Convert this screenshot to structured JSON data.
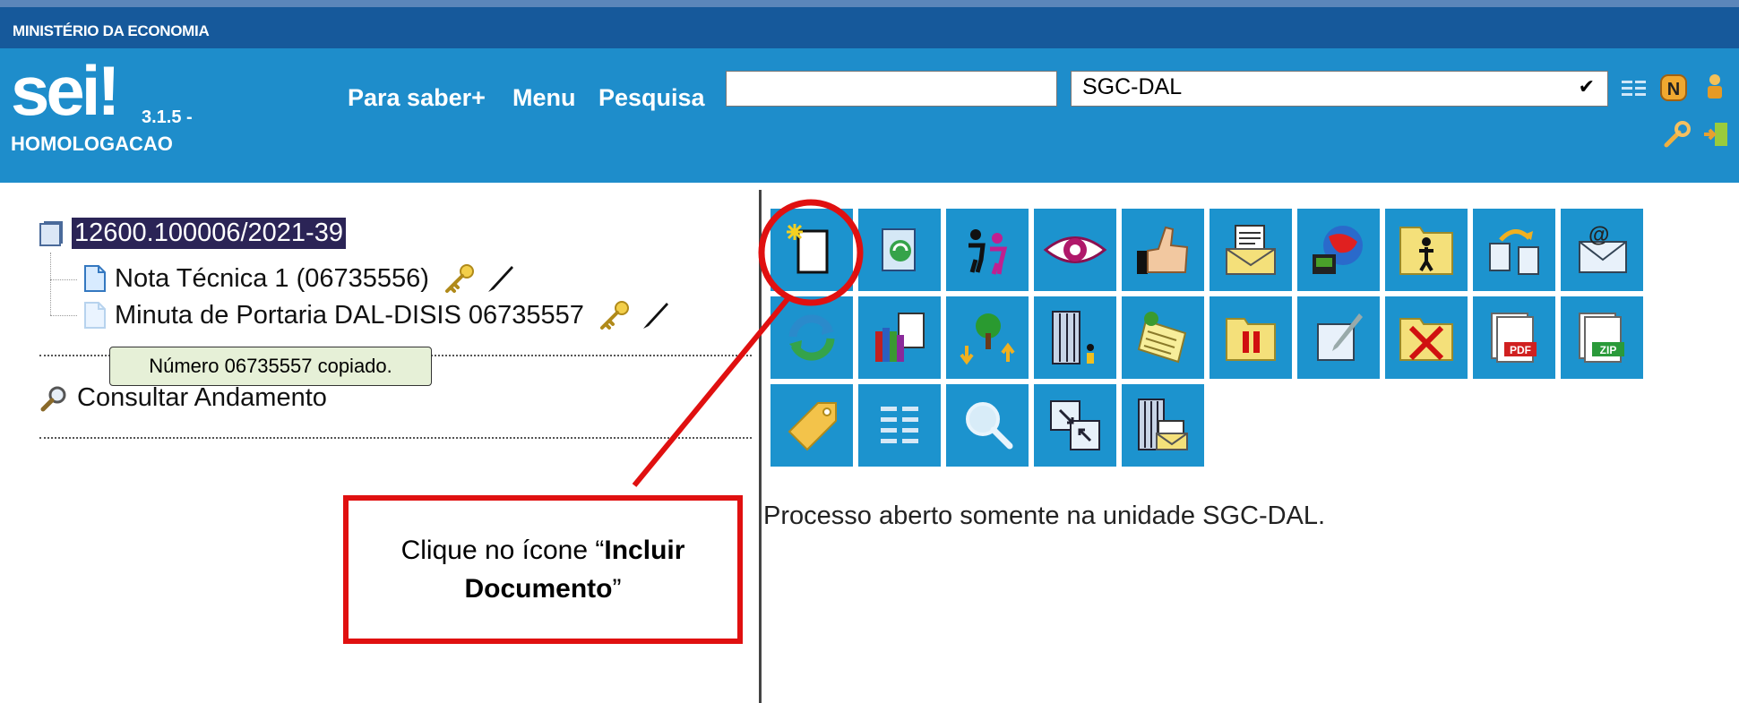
{
  "header": {
    "ministry": "MINISTÉRIO DA ECONOMIA",
    "logo_text": "sei",
    "logo_mark": "!",
    "version": "3.1.5 -",
    "environment": "HOMOLOGACAO",
    "nav_items": [
      "Para saber+",
      "Menu",
      "Pesquisa"
    ],
    "search_value": "",
    "unit_selected": "SGC-DAL",
    "icons": [
      "list-icon",
      "n-badge-icon",
      "user-icon",
      "wrench-icon",
      "exit-icon"
    ],
    "colors": {
      "topstrip": "#5b86ba",
      "ministry_bar": "#16599b",
      "header_bg": "#1e8dcb"
    }
  },
  "tree": {
    "process_number": "12600.100006/2021-39",
    "documents": [
      {
        "label": "Nota Técnica 1 (06735556)",
        "icon": "document-icon"
      },
      {
        "label": "Minuta de Portaria DAL-DISIS 06735557",
        "icon": "document-faded-icon"
      }
    ],
    "tooltip": "Número 06735557 copiado.",
    "consult_label": "Consultar Andamento"
  },
  "toolbar": {
    "rows": [
      [
        "include-document-icon",
        "edit-process-icon",
        "participants-icon",
        "view-icon",
        "approve-icon",
        "envelope-icon",
        "globe-icon",
        "folder-person-icon",
        "relocate-icon",
        "email-icon"
      ],
      [
        "refresh-icon",
        "books-icon",
        "tree-arrows-icon",
        "building-person-icon",
        "notes-icon",
        "pause-folder-icon",
        "sign-icon",
        "cancel-folder-icon",
        "pdf-icon",
        "zip-icon"
      ],
      [
        "tag-icon",
        "list-icon",
        "search-icon",
        "zoom-box-icon",
        "building-mail-icon"
      ]
    ],
    "cell_color": "#1c93ce"
  },
  "status_message": "Processo aberto somente na unidade SGC-DAL.",
  "annotation": {
    "line1": "Clique no ícone “",
    "bold1": "Incluir",
    "bold2": "Documento",
    "end": "”",
    "color": "#e01010"
  }
}
